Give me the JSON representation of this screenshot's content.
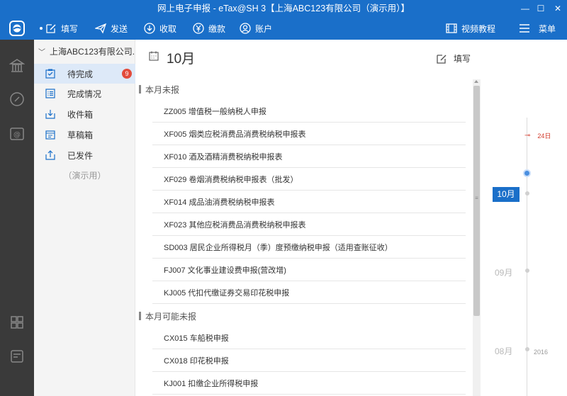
{
  "window": {
    "title": "网上电子申报 - eTax@SH 3【上海ABC123有限公司（演示用）】",
    "minimize": "—",
    "maximize": "☐",
    "close": "✕"
  },
  "toolbar": {
    "fill_label": "填写",
    "send_label": "发送",
    "receive_label": "收取",
    "pay_label": "缴款",
    "account_label": "账户",
    "video_label": "视频教程",
    "menu_label": "菜单"
  },
  "nav": {
    "company": "上海ABC123有限公司...",
    "items": [
      {
        "label": "待完成",
        "badge": "9"
      },
      {
        "label": "完成情况"
      },
      {
        "label": "收件箱"
      },
      {
        "label": "草稿箱"
      },
      {
        "label": "已发件"
      }
    ],
    "demo_note": "（演示用）"
  },
  "main": {
    "month_title": "10月",
    "fill_label": "填写",
    "sections": [
      {
        "title": "本月未报",
        "rows": [
          "ZZ005 增值税一般纳税人申报",
          "XF005 烟类应税消费品消费税纳税申报表",
          "XF010 酒及酒精消费税纳税申报表",
          "XF029 卷烟消费税纳税申报表（批发）",
          "XF014 成品油消费税纳税申报表",
          "XF023 其他应税消费品消费税纳税申报表",
          "SD003 居民企业所得税月（季）度预缴纳税申报（适用查账征收）",
          "FJ007 文化事业建设费申报(营改增)",
          "KJ005 代扣代缴证券交易印花税申报"
        ]
      },
      {
        "title": "本月可能未报",
        "rows": [
          "CX015 车船税申报",
          "CX018 印花税申报",
          "KJ001 扣缴企业所得税申报"
        ]
      }
    ]
  },
  "timeline": {
    "deadline": "24日",
    "current_month": "10月",
    "months": [
      "09月",
      "08月"
    ],
    "year": "2016"
  },
  "colors": {
    "accent": "#1a6fc9",
    "rail": "#3a3a3a",
    "badge": "#e24b3b",
    "deadline": "#d23a2b"
  }
}
